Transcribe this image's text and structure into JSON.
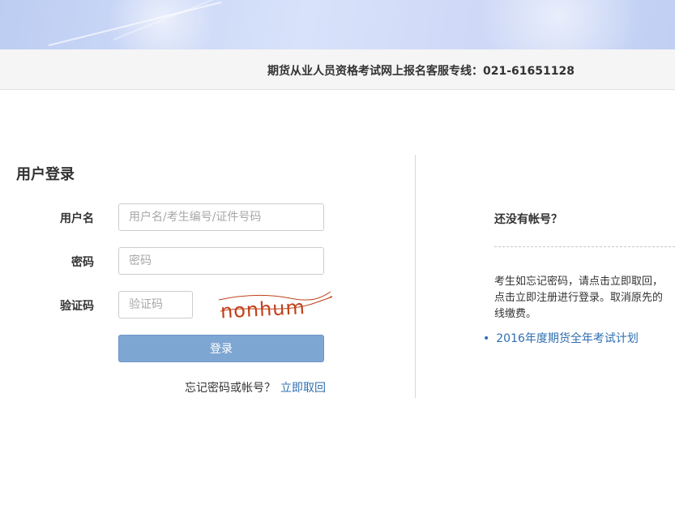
{
  "header": {
    "hotline": "期货从业人员资格考试网上报名客服专线：021-61651128"
  },
  "login": {
    "title": "用户登录",
    "username_label": "用户名",
    "username_placeholder": "用户名/考生编号/证件号码",
    "username_value": "",
    "password_label": "密码",
    "password_placeholder": "密码",
    "password_value": "",
    "captcha_label": "验证码",
    "captcha_placeholder": "验证码",
    "captcha_value": "",
    "captcha_text": "nonhum",
    "submit_label": "登录",
    "forgot_text": "忘记密码或帐号？",
    "forgot_link": "立即取回"
  },
  "side": {
    "no_account_title": "还没有帐号？",
    "info_lines": [
      "考生如忘记密码，请点击立即取回，",
      "点击立即注册进行登录。取消原先的",
      "线缴费。"
    ],
    "plan_link": "2016年度期货全年考试计划"
  },
  "colors": {
    "button_bg": "#7ea6d2",
    "link": "#2f6fb0",
    "captcha_text": "#c0401a"
  }
}
